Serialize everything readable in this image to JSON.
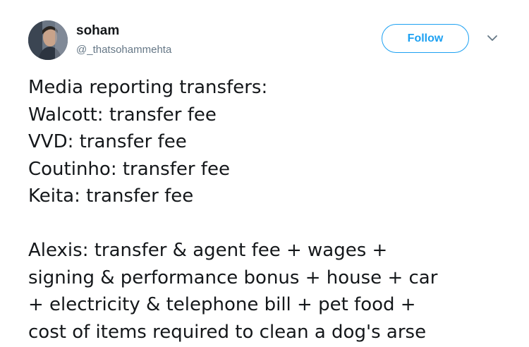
{
  "tweet": {
    "author": {
      "name": "soham",
      "handle": "@_thatsohammehta",
      "avatar_icon": "user-avatar-icon"
    },
    "follow_label": "Follow",
    "menu_icon": "chevron-down-icon",
    "accent_color": "#1da1f2",
    "text_color": "#14171a",
    "secondary_color": "#657786",
    "paragraphs": [
      {
        "lines": [
          "Media reporting transfers:",
          "Walcott: transfer fee",
          "VVD: transfer fee",
          "Coutinho: transfer fee",
          "Keita: transfer fee"
        ]
      },
      {
        "lines": [
          "Alexis: transfer & agent fee + wages +",
          "signing & performance bonus + house + car",
          "+ electricity & telephone bill + pet food +",
          "cost of items required to clean a dog's arse"
        ]
      }
    ]
  }
}
